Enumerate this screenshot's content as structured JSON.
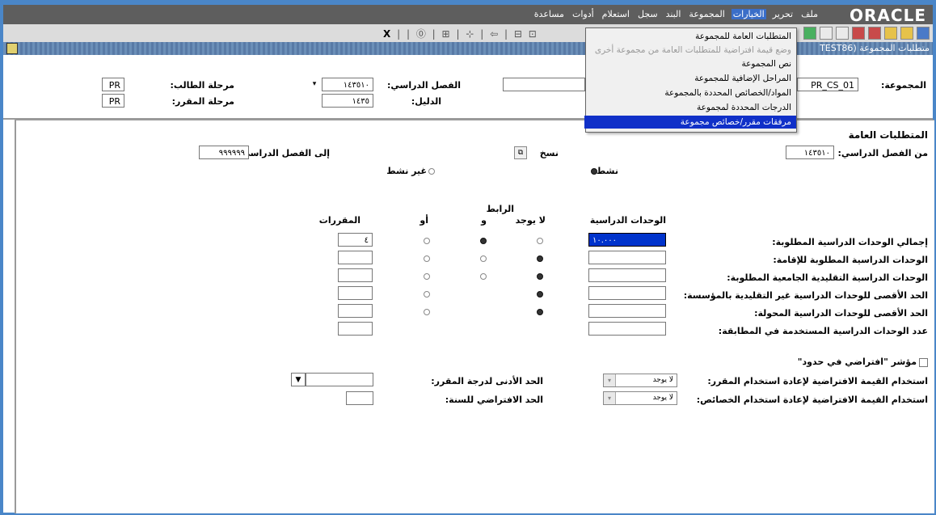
{
  "app": {
    "logo": "ORACLE"
  },
  "menubar": {
    "items": [
      "ملف",
      "تحرير",
      "الخيارات",
      "المجموعة",
      "البند",
      "سجل",
      "استعلام",
      "أدوات",
      "مساعدة"
    ],
    "active_index": 2
  },
  "toolbar": {
    "close": "X"
  },
  "form_title": "متطلبات المجموعة  (TEST86",
  "key_block": {
    "group_label": "المجموعة:",
    "group_value": "PR_CS_01",
    "term_label": "الفصل الدراسي:",
    "term_value": "١٤٣٥١٠",
    "catalog_label": "الدليل:",
    "catalog_value": "١٤٣٥",
    "student_level_label": "مرحلة الطالب:",
    "student_level_value": "PR",
    "course_level_label": "مرحلة المقرر:",
    "course_level_value": "PR"
  },
  "options_menu": {
    "items": [
      {
        "label": "المتطلبات العامة للمجموعة",
        "state": "normal"
      },
      {
        "label": "وضع قيمة افتراضية للمتطلبات العامة من مجموعة أخرى",
        "state": "disabled"
      },
      {
        "label": "نص المجموعة",
        "state": "normal"
      },
      {
        "label": "المراحل الإضافية للمجموعة",
        "state": "normal"
      },
      {
        "label": "المواد/الخصائص المحددة بالمجموعة",
        "state": "normal"
      },
      {
        "label": "الدرجات المحددة لمجموعة",
        "state": "normal"
      },
      {
        "label": "مرفقات مقرر/خصائص مجموعة",
        "state": "highlight"
      }
    ]
  },
  "main": {
    "section_title": "المتطلبات العامة",
    "from_term_label": "من الفصل الدراسي:",
    "from_term_value": "١٤٣٥١٠",
    "copy_label": "نسخ",
    "to_term_label": "إلى الفصل الدراسي:",
    "to_term_value": "٩٩٩٩٩٩",
    "active_label": "نشط",
    "inactive_label": "غير نشط",
    "status_active": true,
    "connector_header": "الرابط",
    "col_credits": "الوحدات الدراسية",
    "col_none": "لا يوجد",
    "col_and": "و",
    "col_or": "أو",
    "col_courses": "المقررات",
    "rows": [
      {
        "label": "إجمالي الوحدات الدراسية المطلوبة:",
        "credits": "١٠.٠٠٠",
        "connector": "and",
        "or_radio": true,
        "and_radio": true,
        "none_radio": true,
        "courses": "٤",
        "selected": true
      },
      {
        "label": "الوحدات الدراسية المطلوبة للإقامة:",
        "credits": "",
        "connector": "none",
        "or_radio": true,
        "and_radio": true,
        "none_radio": true,
        "courses": "",
        "selected": false
      },
      {
        "label": "الوحدات الدراسية التقليدية الجامعية المطلوبة:",
        "credits": "",
        "connector": "none",
        "or_radio": true,
        "and_radio": true,
        "none_radio": true,
        "courses": "",
        "selected": false
      },
      {
        "label": "الحد الأقصى للوحدات الدراسية غير التقليدية بالمؤسسة:",
        "credits": "",
        "connector": "none",
        "or_radio": true,
        "and_radio": false,
        "none_radio": true,
        "courses": "",
        "selected": false
      },
      {
        "label": "الحد الأقصى للوحدات الدراسية المحولة:",
        "credits": "",
        "connector": "none",
        "or_radio": true,
        "and_radio": false,
        "none_radio": true,
        "courses": "",
        "selected": false
      },
      {
        "label": "عدد الوحدات الدراسية المستخدمة في المطابقة:",
        "credits": "",
        "connector": "",
        "or_radio": false,
        "and_radio": false,
        "none_radio": false,
        "courses": "",
        "selected": false
      }
    ],
    "default_limits_label": "مؤشر \"افتراضي في حدود\"",
    "course_reuse_label": "استخدام القيمة الافتراضية لإعادة استخدام المقرر:",
    "course_reuse_value": "لا يوجد",
    "attr_reuse_label": "استخدام القيمة الافتراضية لإعادة استخدام الخصائص:",
    "attr_reuse_value": "لا يوجد",
    "min_grade_label": "الحد الأدنى لدرجة المقرر:",
    "min_grade_value": "",
    "default_year_label": "الحد الافتراضي للسنة:",
    "default_year_value": ""
  }
}
